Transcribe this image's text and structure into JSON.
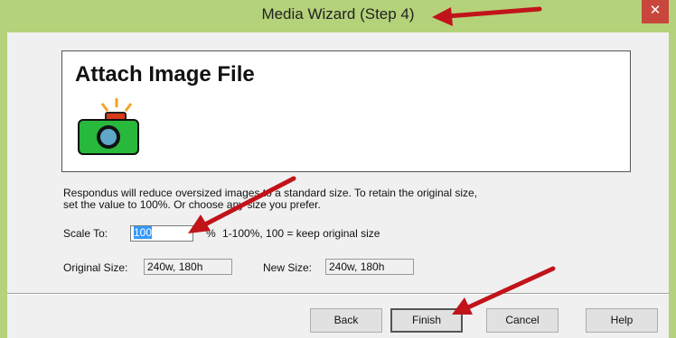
{
  "window": {
    "title": "Media Wizard (Step 4)",
    "close": "✕"
  },
  "header": {
    "title": "Attach Image File",
    "icon": "camera-icon"
  },
  "description": {
    "line1": "Respondus will reduce oversized images to a standard size.  To retain the original size,",
    "line2": "set the value to 100%.  Or choose any size you prefer."
  },
  "scale": {
    "label": "Scale To:",
    "value": "100",
    "unit": "%",
    "hint": "1-100%, 100 = keep original size"
  },
  "sizes": {
    "original_label": "Original Size:",
    "original_value": "240w, 180h",
    "new_label": "New Size:",
    "new_value": "240w, 180h"
  },
  "buttons": {
    "back": "Back",
    "finish": "Finish",
    "cancel": "Cancel",
    "help": "Help"
  },
  "colors": {
    "title_bar": "#b4d27a",
    "annotation_arrow": "#c0141a",
    "camera_body": "#27b83c",
    "selection": "#3399ff"
  }
}
